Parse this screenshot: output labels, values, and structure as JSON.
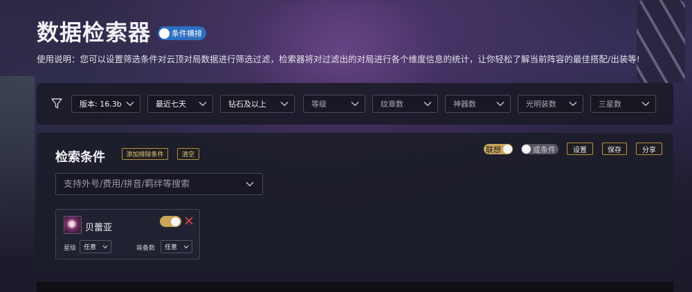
{
  "header": {
    "title": "数据检索器",
    "layout_toggle_label": "条件横排",
    "description": "使用说明：您可以设置筛选条件对云顶对局数据进行筛选过滤，检索器将对过滤出的对局进行各个维度信息的统计，让你轻松了解当前阵容的最佳搭配/出装等!"
  },
  "filters": {
    "icon": "filter-icon",
    "dropdowns": [
      {
        "label": "版本: 16.3b",
        "state": "selected"
      },
      {
        "label": "最近七天",
        "state": "selected"
      },
      {
        "label": "钻石及以上",
        "state": "selected"
      },
      {
        "label": "等级",
        "state": "placeholder"
      },
      {
        "label": "纹章数",
        "state": "placeholder"
      },
      {
        "label": "神器数",
        "state": "placeholder"
      },
      {
        "label": "光明装数",
        "state": "placeholder"
      },
      {
        "label": "三星数",
        "state": "placeholder"
      }
    ]
  },
  "search_panel": {
    "title": "检索条件",
    "add_exclude_label": "添加排除条件",
    "clear_label": "清空",
    "suggest_label": "联想",
    "or_condition_label": "或条件",
    "settings_label": "设置",
    "save_label": "保存",
    "share_label": "分享",
    "search_placeholder": "支持外号/费用/拼音/羁绊等搜索",
    "champion_card": {
      "name": "贝蕾亚",
      "star_label": "星级",
      "star_value": "任意",
      "items_label": "装备数",
      "items_value": "任意"
    }
  },
  "colors": {
    "accent_gold": "#c8a55a",
    "toggle_blue": "#2d6fc1",
    "remove_red": "#e0443a"
  }
}
